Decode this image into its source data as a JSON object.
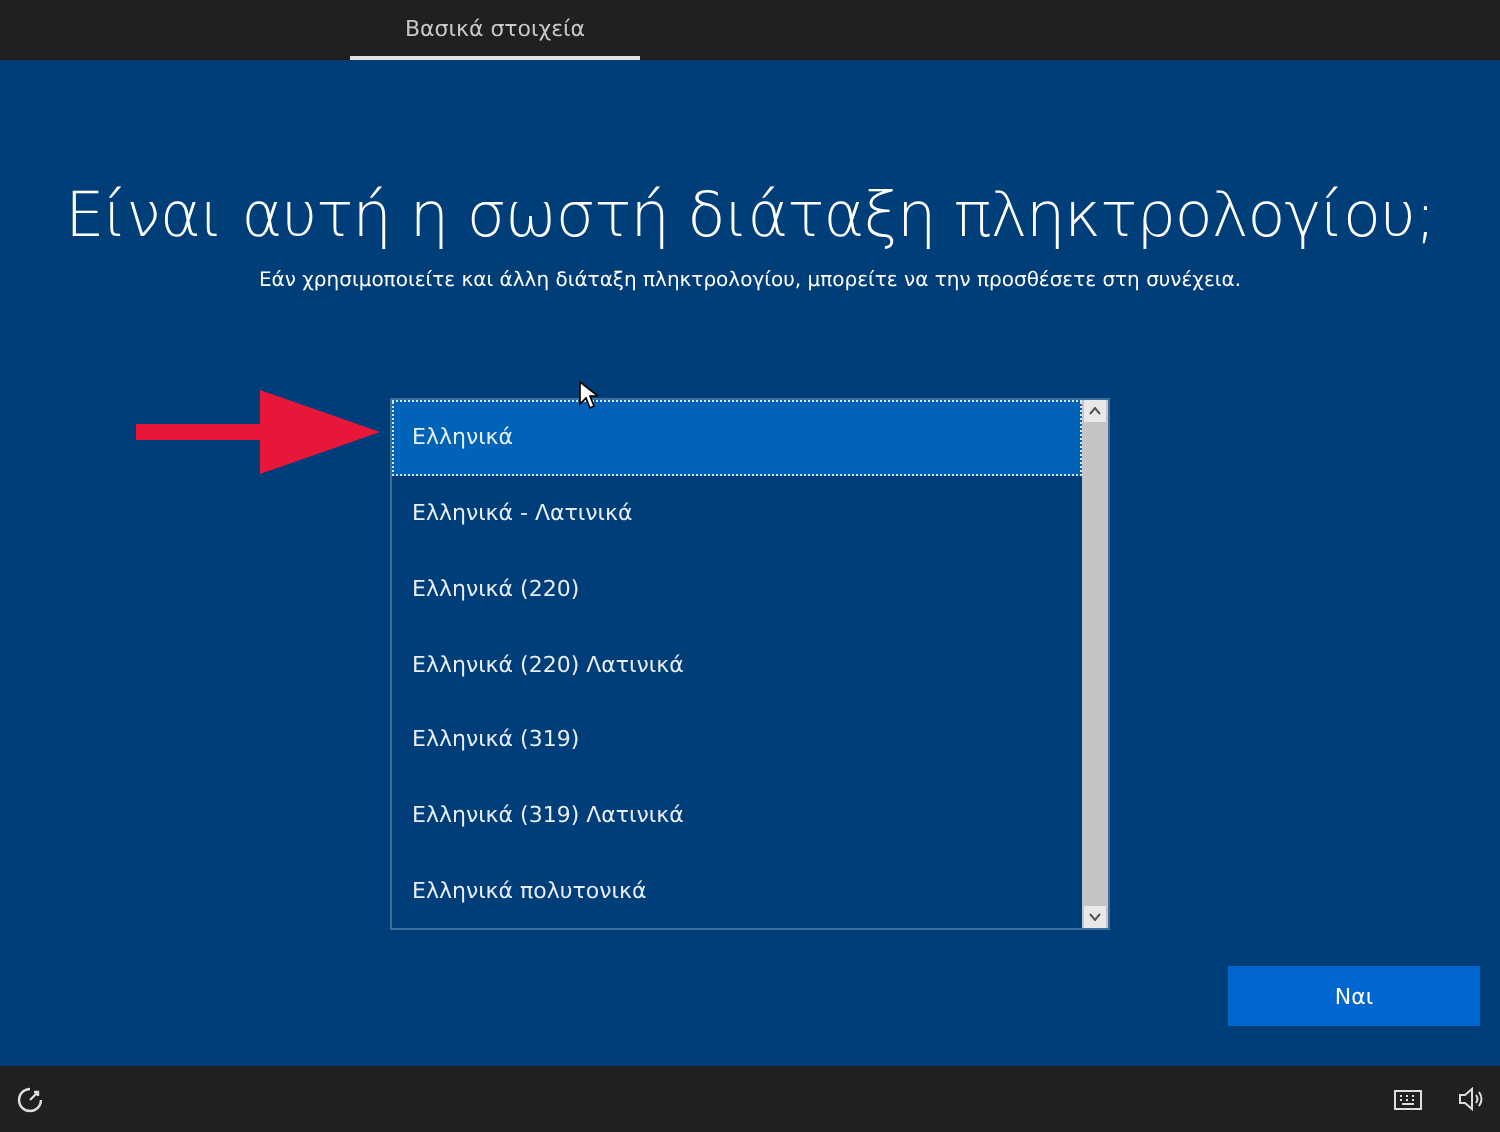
{
  "header": {
    "tabs": [
      {
        "label": "Βασικά στοιχεία",
        "selected": true
      }
    ]
  },
  "title": "Είναι αυτή η σωστή διάταξη πληκτρολογίου;",
  "subtitle": "Εάν χρησιμοποιείτε και άλλη διάταξη πληκτρολογίου, μπορείτε να την προσθέσετε στη συνέχεια.",
  "layouts": [
    {
      "label": "Ελληνικά",
      "selected": true
    },
    {
      "label": "Ελληνικά - Λατινικά",
      "selected": false
    },
    {
      "label": "Ελληνικά (220)",
      "selected": false
    },
    {
      "label": "Ελληνικά (220) Λατινικά",
      "selected": false
    },
    {
      "label": "Ελληνικά (319)",
      "selected": false
    },
    {
      "label": "Ελληνικά (319) Λατινικά",
      "selected": false
    },
    {
      "label": "Ελληνικά πολυτονικά",
      "selected": false
    }
  ],
  "buttons": [
    {
      "label": "Ναι"
    }
  ]
}
